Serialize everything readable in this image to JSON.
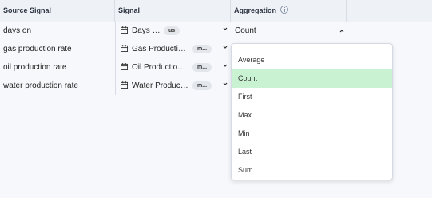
{
  "header": {
    "source_signal": "Source Signal",
    "signal": "Signal",
    "aggregation": "Aggregation",
    "aggregation_icon": "info-icon"
  },
  "rows": [
    {
      "source": "days on",
      "signal": "Days On",
      "unit": "us",
      "aggregation": "Count"
    },
    {
      "source": "gas production rate",
      "signal": "Gas Production...",
      "unit": "m..."
    },
    {
      "source": "oil production rate",
      "signal": "Oil Production ...",
      "unit": "m..."
    },
    {
      "source": "water production rate",
      "signal": "Water Producti...",
      "unit": "m..."
    }
  ],
  "aggregation_menu": {
    "selected": "Count",
    "options": [
      "Average",
      "Count",
      "First",
      "Max",
      "Min",
      "Last",
      "Sum"
    ]
  },
  "colors": {
    "selected_option": "#c9f2d3",
    "header_bg": "#eef2f7"
  }
}
